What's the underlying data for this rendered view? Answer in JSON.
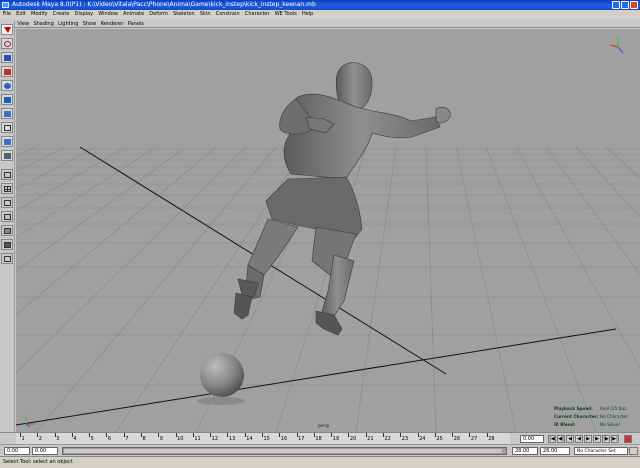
{
  "window": {
    "title": "Autodesk Maya 8.0(P1) : K:\\Video\\Vitala\\Pacc\\Phone\\Anima\\Game\\kick_instep\\kick_instep_keenan.mb"
  },
  "menus": [
    "File",
    "Edit",
    "Modify",
    "Create",
    "Display",
    "Window",
    "Animate",
    "Deform",
    "Skeleton",
    "Skin",
    "Constrain",
    "Character",
    "WE Tools",
    "Help"
  ],
  "panel_menus": [
    "View",
    "Shading",
    "Lighting",
    "Show",
    "Renderer",
    "Panels"
  ],
  "viewport": {
    "camera_label": "persp"
  },
  "hud": [
    {
      "label": "Playback Speed:",
      "value": "Real (25 fps)"
    },
    {
      "label": "Current Character:",
      "value": "No Character"
    },
    {
      "label": "IK Blend:",
      "value": "No Solver"
    }
  ],
  "timeslider": {
    "ticks": [
      "1",
      "2",
      "3",
      "4",
      "5",
      "6",
      "7",
      "8",
      "9",
      "10",
      "11",
      "12",
      "13",
      "14",
      "15",
      "16",
      "17",
      "18",
      "19",
      "20",
      "21",
      "22",
      "23",
      "24",
      "25",
      "26",
      "27",
      "28"
    ],
    "current_time": "0.00"
  },
  "rangeslider": {
    "start": "0.00",
    "range_start": "0.00",
    "range_end": "28.00",
    "end": "28.00",
    "character": "No Character Set"
  },
  "helpline": "Select Tool: select an object",
  "colors": {
    "titlebar": "#1f5fe0",
    "viewport_bg": "#a0a0a0",
    "grid": "#878787",
    "hud_text": "#0f3d1a"
  }
}
